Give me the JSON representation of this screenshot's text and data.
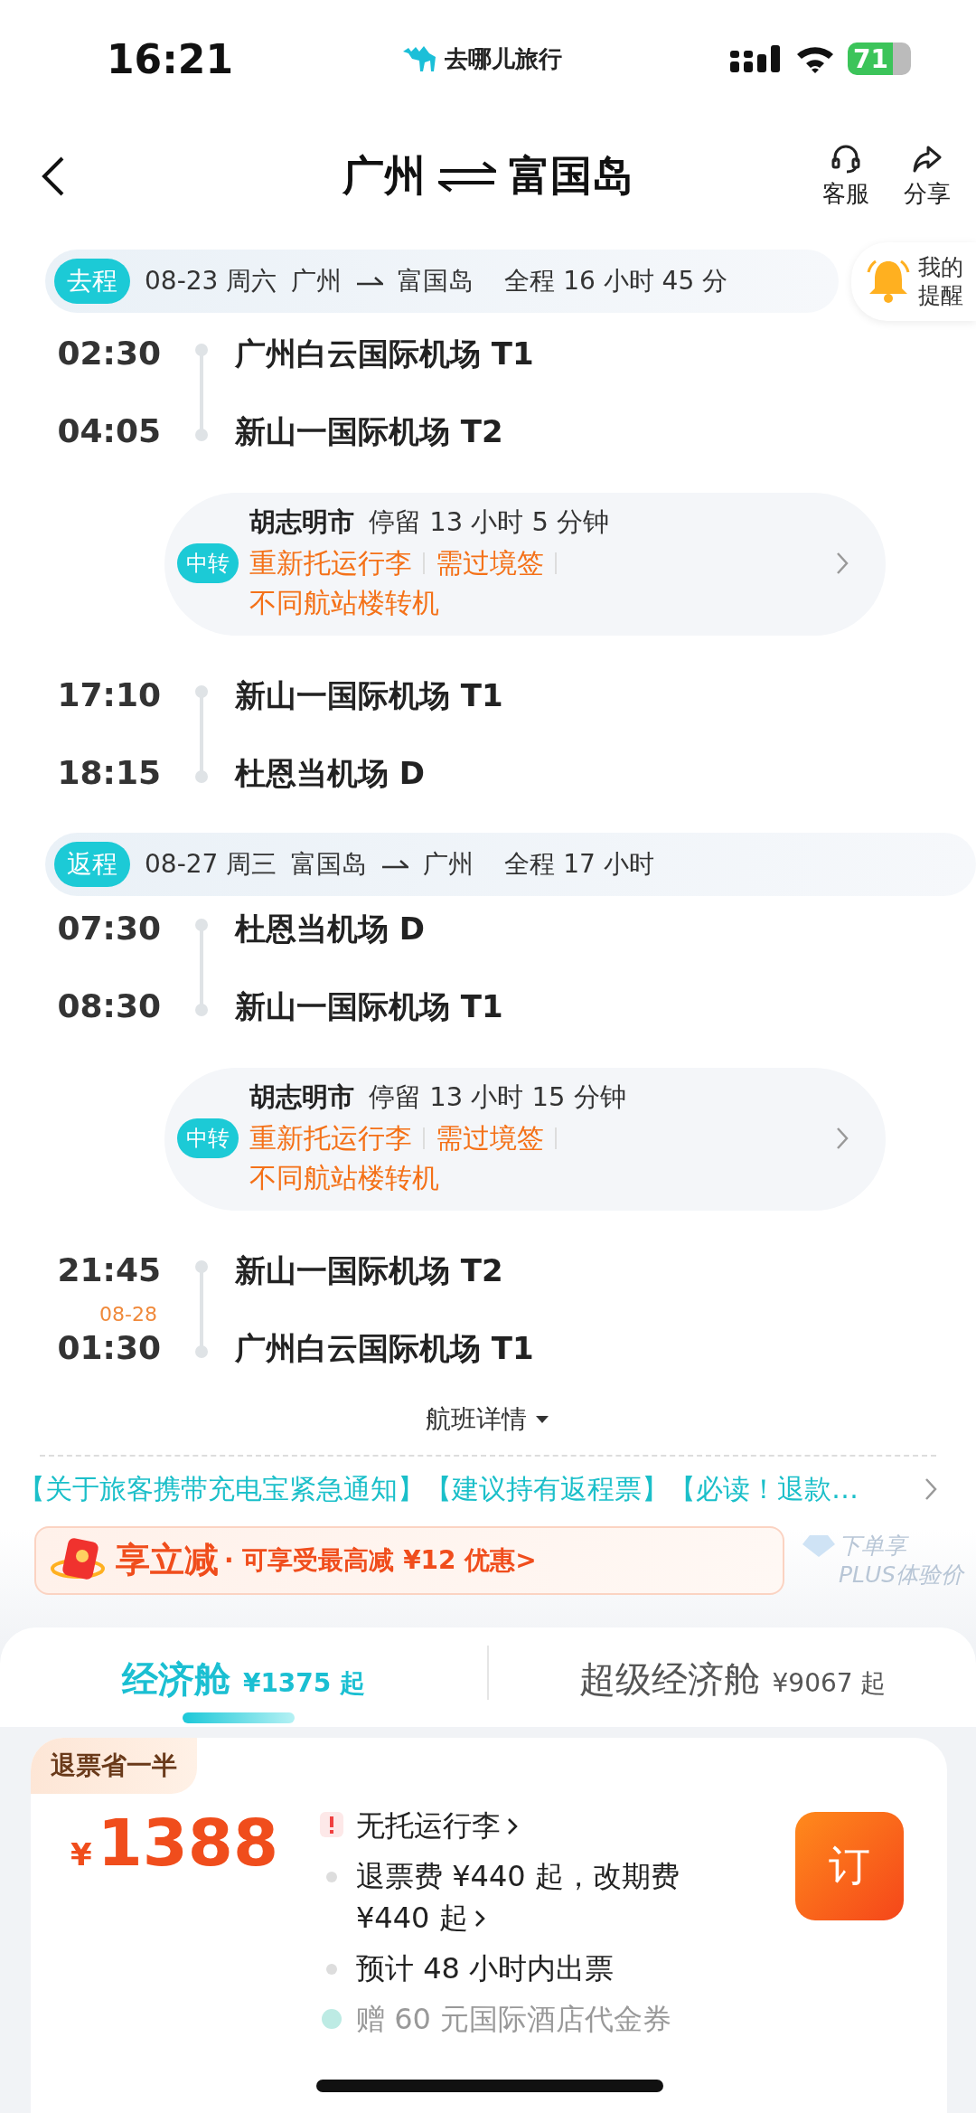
{
  "status_bar": {
    "time": "16:21",
    "app_name": "去哪儿旅行",
    "battery": "71"
  },
  "header": {
    "from": "广州",
    "to": "富国岛",
    "actions": [
      {
        "kind": "service",
        "label": "客服"
      },
      {
        "kind": "share",
        "label": "分享"
      }
    ]
  },
  "reminder": {
    "label": "我的提醒"
  },
  "trips": [
    {
      "tag": "去程",
      "date": "08-23 周六",
      "from": "广州",
      "to": "富国岛",
      "duration": "全程 16 小时 45 分",
      "segments": [
        {
          "kind": "flight",
          "dep_time": "02:30",
          "dep_airport": "广州白云国际机场 T1",
          "arr_time": "04:05",
          "arr_airport": "新山一国际机场 T2"
        },
        {
          "kind": "transfer",
          "badge": "中转",
          "city": "胡志明市",
          "stay": "停留 13 小时 5 分钟",
          "notes": [
            "重新托运行李",
            "需过境签",
            "不同航站楼转机"
          ]
        },
        {
          "kind": "flight",
          "dep_time": "17:10",
          "dep_airport": "新山一国际机场 T1",
          "arr_time": "18:15",
          "arr_airport": "杜恩当机场 D"
        }
      ]
    },
    {
      "tag": "返程",
      "date": "08-27 周三",
      "from": "富国岛",
      "to": "广州",
      "duration": "全程 17 小时",
      "segments": [
        {
          "kind": "flight",
          "dep_time": "07:30",
          "dep_airport": "杜恩当机场 D",
          "arr_time": "08:30",
          "arr_airport": "新山一国际机场 T1"
        },
        {
          "kind": "transfer",
          "badge": "中转",
          "city": "胡志明市",
          "stay": "停留 13 小时 15 分钟",
          "notes": [
            "重新托运行李",
            "需过境签",
            "不同航站楼转机"
          ]
        },
        {
          "kind": "flight",
          "dep_time": "21:45",
          "dep_airport": "新山一国际机场 T2",
          "arr_date": "08-28",
          "arr_time": "01:30",
          "arr_airport": "广州白云国际机场 T1"
        }
      ]
    }
  ],
  "flight_details": "航班详情",
  "notice": "【关于旅客携带充电宝紧急通知】【建议持有返程票】【必读！退款…",
  "promo": {
    "title": "享立减",
    "text": "· 可享受最高减 ¥12 优惠>",
    "side_line_1": "下单享",
    "side_line_2": "PLUS体验价"
  },
  "cabins": [
    {
      "name": "经济舱",
      "price": "¥1375 起",
      "selected": true
    },
    {
      "name": "超级经济舱",
      "price": "¥9067 起",
      "selected": false
    }
  ],
  "fare": {
    "tag": "退票省一半",
    "currency": "¥",
    "price": "1388",
    "book": "订",
    "features": [
      {
        "kind": "warning",
        "text": "无托运行李",
        "link": true
      },
      {
        "kind": "bullet",
        "text": "退票费 ¥440 起，改期费 ¥440 起",
        "link": true
      },
      {
        "kind": "bullet",
        "text": "预计 48 小时内出票",
        "link": false
      },
      {
        "kind": "gift",
        "text": "赠 60 元国际酒店代金券",
        "link": false
      }
    ]
  }
}
